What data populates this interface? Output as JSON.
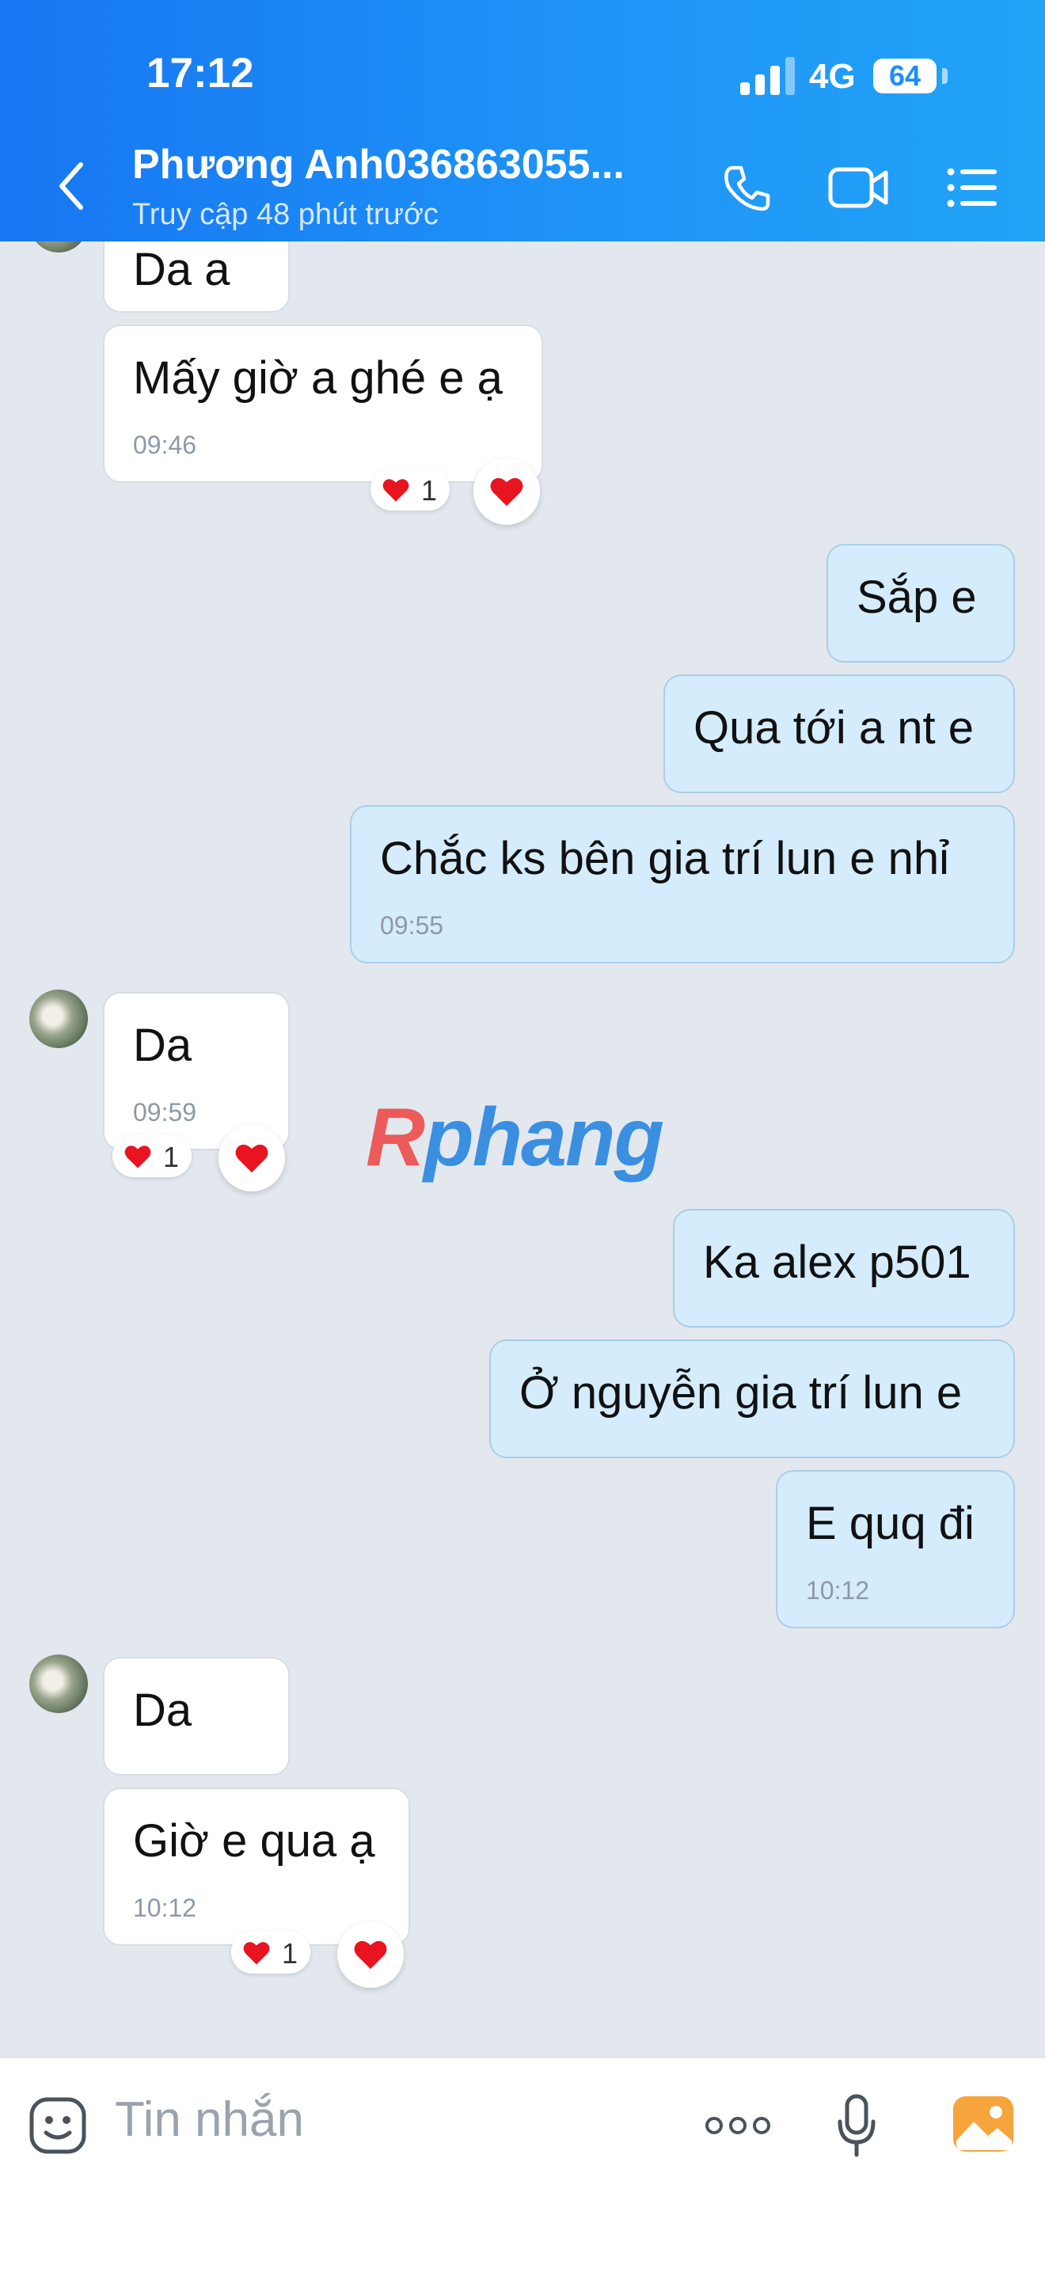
{
  "status": {
    "time": "17:12",
    "network": "4G",
    "battery": "64"
  },
  "header": {
    "contact_name": "Phương Anh036863055...",
    "last_seen": "Truy cập 48 phút trước"
  },
  "messages": [
    {
      "side": "in",
      "text": "Da a"
    },
    {
      "side": "in",
      "text": "Mấy giờ a ghé e ạ",
      "time": "09:46",
      "reaction_count": "1"
    },
    {
      "side": "out",
      "text": "Sắp e"
    },
    {
      "side": "out",
      "text": "Qua tới a nt e"
    },
    {
      "side": "out",
      "text": "Chắc ks bên gia trí lun e nhỉ",
      "time": "09:55"
    },
    {
      "side": "in",
      "text": "Da",
      "time": "09:59",
      "reaction_count": "1"
    },
    {
      "side": "out",
      "text": "Ka alex p501"
    },
    {
      "side": "out",
      "text": "Ở nguyễn gia trí lun e"
    },
    {
      "side": "out",
      "text": "E quq đi",
      "time": "10:12"
    },
    {
      "side": "in",
      "text": "Da"
    },
    {
      "side": "in",
      "text": "Giờ e qua ạ",
      "time": "10:12",
      "reaction_count": "1"
    }
  ],
  "watermark": {
    "part1": "R",
    "part2": "phang"
  },
  "input": {
    "placeholder": "Tin nhắn"
  },
  "icons": {
    "back": "chevron-left-icon",
    "call": "phone-icon",
    "video": "video-camera-icon",
    "menu": "list-menu-icon",
    "emoji": "sticker-face-icon",
    "more": "more-dots-icon",
    "mic": "microphone-icon",
    "image": "image-gallery-icon",
    "heart": "heart-icon"
  },
  "colors": {
    "header_start": "#1776f2",
    "header_end": "#22a4f7",
    "outgoing_bubble": "#d4ecfb",
    "chat_background": "#e3e8ef",
    "heart": "#e8141f"
  }
}
